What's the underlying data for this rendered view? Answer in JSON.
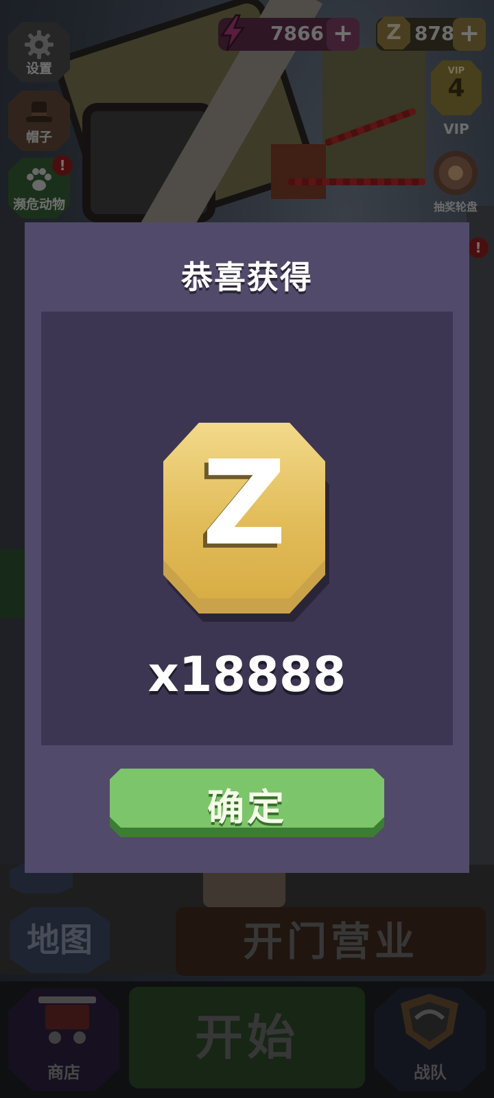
{
  "hud": {
    "settings_label": "设置",
    "hat_label": "帽子",
    "endangered_label": "濒危动物",
    "endangered_badge": "!",
    "energy_value": "7866",
    "coin_value": "878",
    "vip_small": "VIP",
    "vip_level": "4",
    "vip_label": "VIP",
    "wheel_label": "抽奖轮盘",
    "right_badge": "!",
    "plus": "+",
    "coin_glyph": "Z"
  },
  "bottom": {
    "map_label": "地图",
    "open_label": "开门营业",
    "shop_label": "商店",
    "start_label": "开始",
    "team_label": "战队"
  },
  "modal": {
    "title": "恭喜获得",
    "reward_icon": "zcoin-icon",
    "reward_glyph": "Z",
    "amount": "x18888",
    "confirm_label": "确定"
  },
  "colors": {
    "modal_bg": "#524a6a",
    "panel_bg": "#3d3652",
    "confirm_green": "#7cc56a",
    "coin_gold": "#e8c45c"
  }
}
